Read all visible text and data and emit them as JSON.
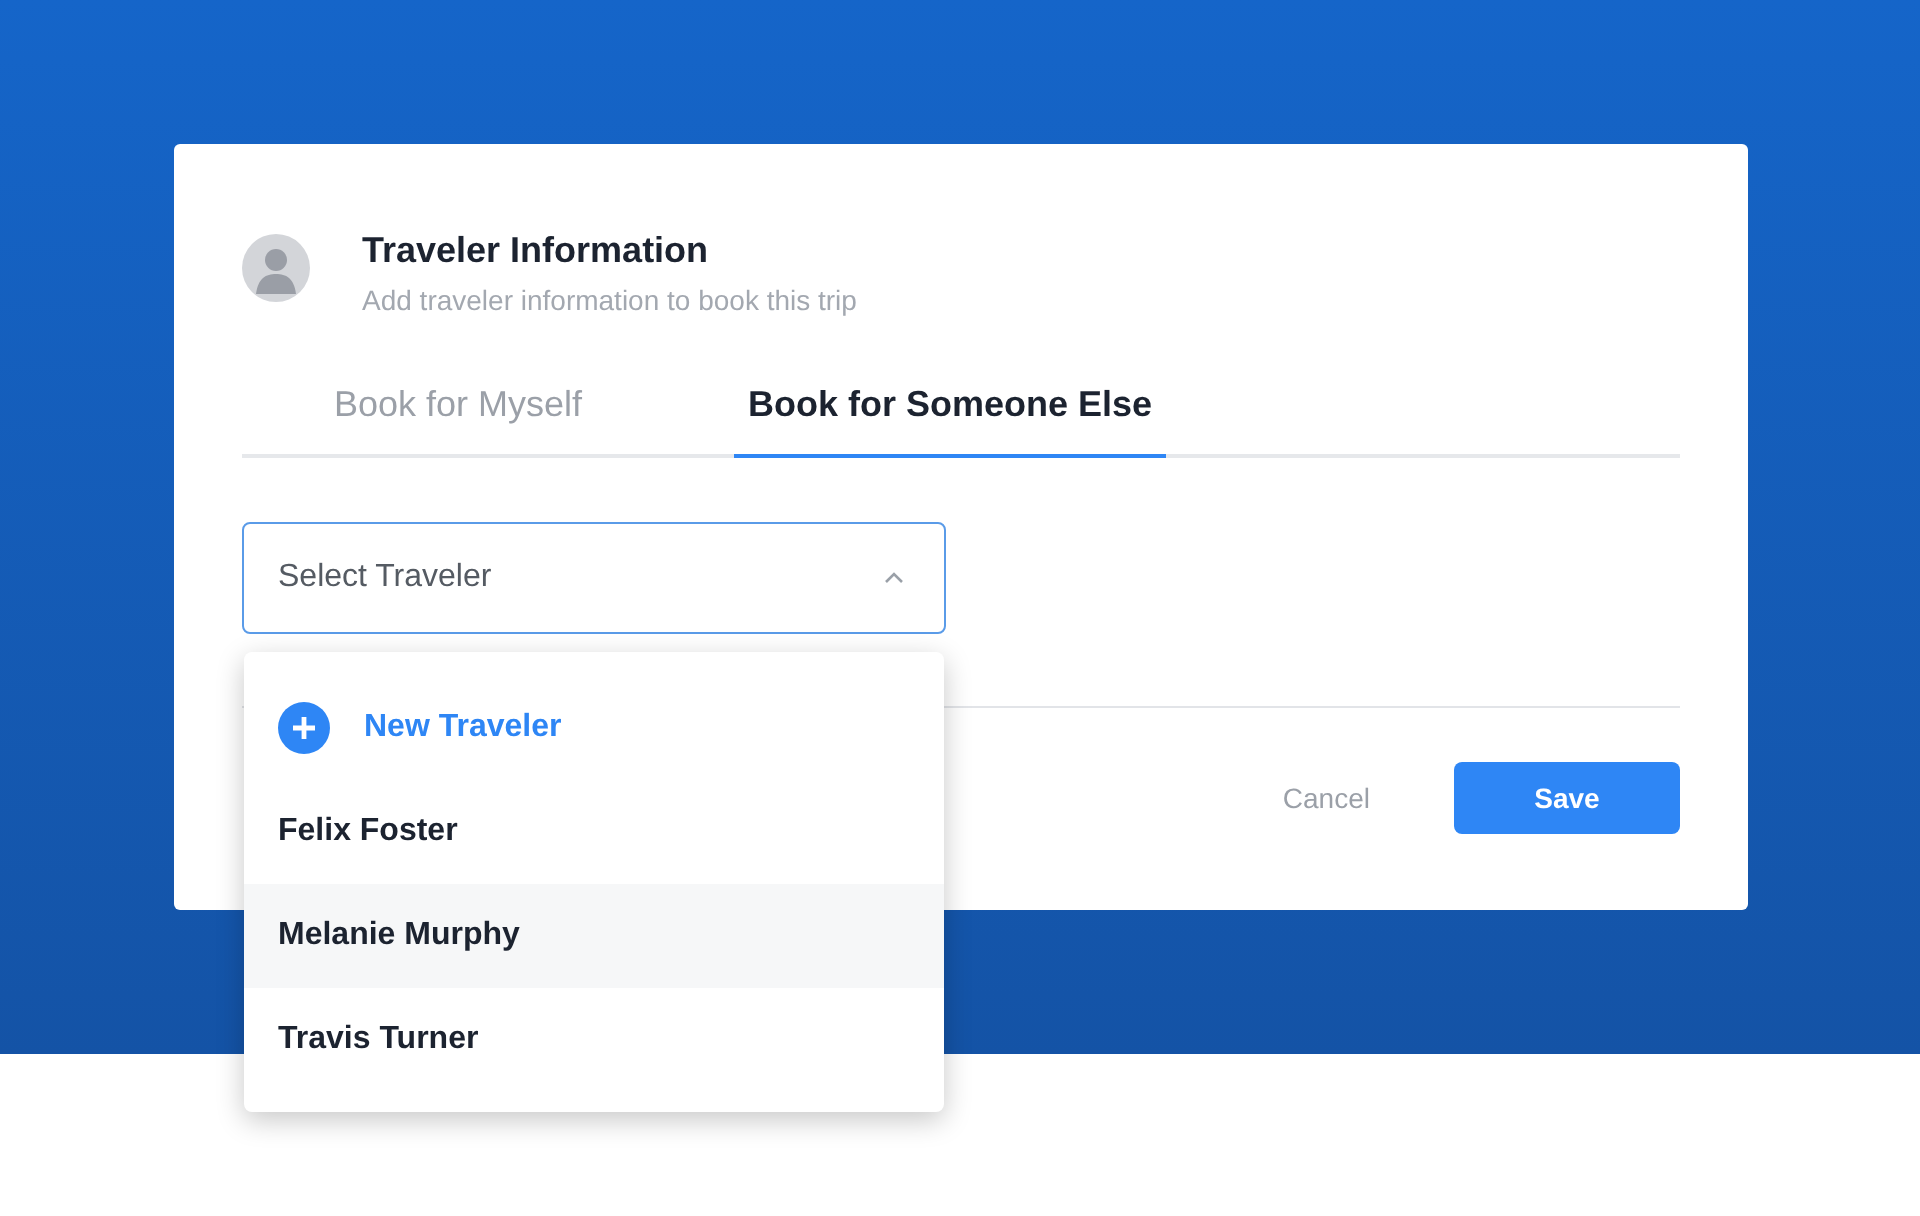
{
  "card": {
    "title": "Traveler Information",
    "subtitle": "Add traveler information to book this trip"
  },
  "tabs": [
    {
      "label": "Book for Myself",
      "selected": false
    },
    {
      "label": "Book for Someone Else",
      "selected": true
    }
  ],
  "select": {
    "placeholder": "Select Traveler",
    "expanded": true
  },
  "options": [
    {
      "kind": "action",
      "label": "New Traveler",
      "highlighted": false
    },
    {
      "kind": "person",
      "label": "Felix Foster",
      "highlighted": false
    },
    {
      "kind": "person",
      "label": "Melanie Murphy",
      "highlighted": true
    },
    {
      "kind": "person",
      "label": "Travis Turner",
      "highlighted": false
    }
  ],
  "buttons": [
    {
      "kind": "secondary",
      "label": "Cancel"
    },
    {
      "kind": "primary",
      "label": "Save"
    }
  ]
}
